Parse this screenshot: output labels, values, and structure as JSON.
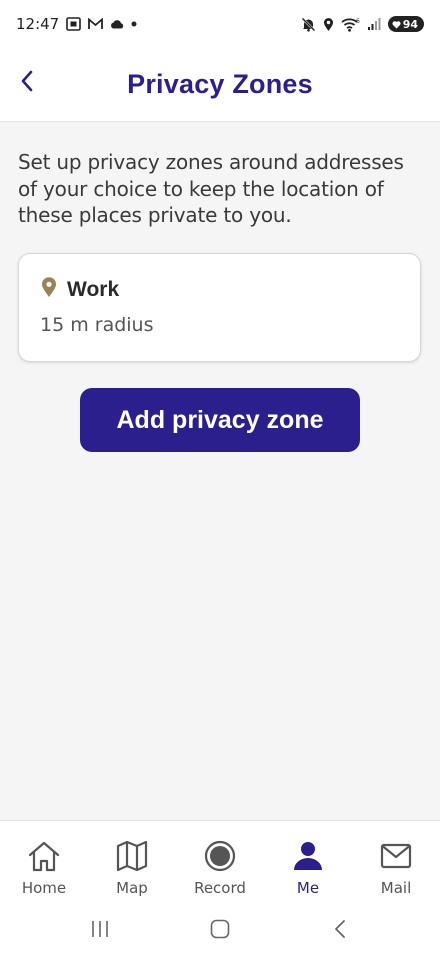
{
  "status_bar": {
    "time": "12:47",
    "battery_level": "94",
    "icons_left": [
      "screenshot-icon",
      "gmail-icon",
      "cloud-icon",
      "dot-icon"
    ],
    "icons_right": [
      "mute-icon",
      "location-icon",
      "wifi-icon",
      "signal-icon",
      "battery-icon"
    ]
  },
  "header": {
    "title": "Privacy Zones",
    "back_icon": "chevron-left-icon"
  },
  "main": {
    "description": "Set up privacy zones around addresses of your choice to keep the location of these places private to you.",
    "zones": [
      {
        "name": "Work",
        "radius": "15 m radius",
        "icon": "map-pin-icon"
      }
    ],
    "add_button_label": "Add privacy zone"
  },
  "bottom_nav": {
    "items": [
      {
        "label": "Home",
        "icon": "home-icon",
        "active": false
      },
      {
        "label": "Map",
        "icon": "map-icon",
        "active": false
      },
      {
        "label": "Record",
        "icon": "record-icon",
        "active": false
      },
      {
        "label": "Me",
        "icon": "person-icon",
        "active": true
      },
      {
        "label": "Mail",
        "icon": "mail-icon",
        "active": false
      }
    ]
  },
  "system_nav": {
    "buttons": [
      "recents-button",
      "home-button",
      "back-button"
    ]
  },
  "colors": {
    "accent": "#2a1f8c",
    "background": "#f5f5f5",
    "card": "#ffffff",
    "pin": "#9a8358"
  }
}
